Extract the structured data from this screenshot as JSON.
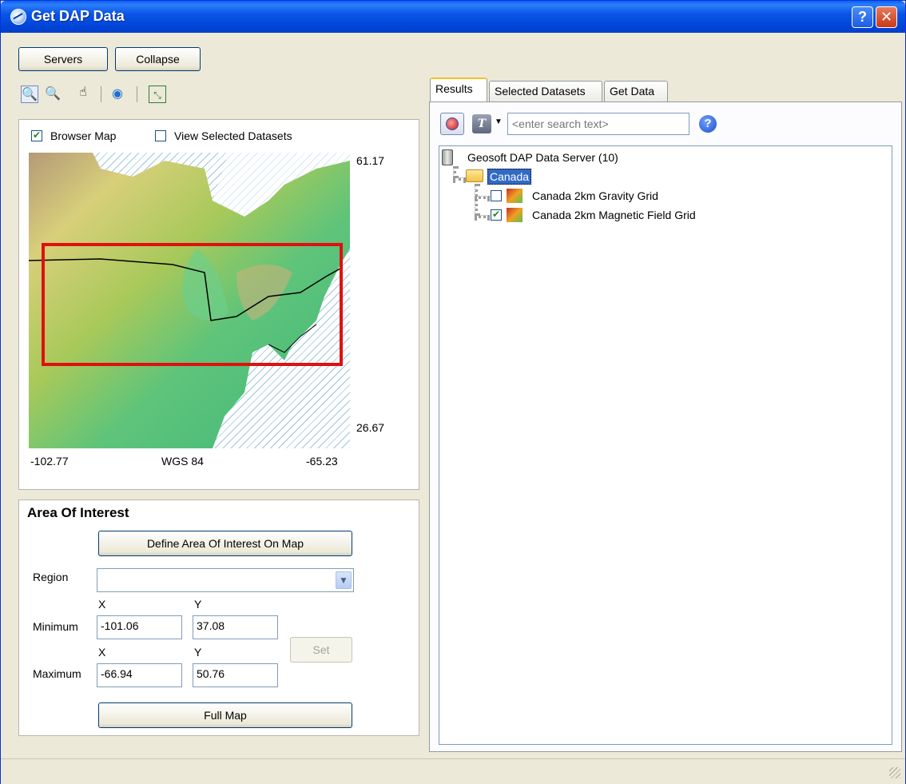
{
  "window": {
    "title": "Get DAP Data",
    "help_glyph": "?",
    "close_glyph": "✕"
  },
  "top_buttons": {
    "servers": "Servers",
    "collapse": "Collapse"
  },
  "map_panel": {
    "browser_map_label": "Browser Map",
    "browser_map_checked": true,
    "view_selected_label": "View Selected Datasets",
    "view_selected_checked": false,
    "lat_max": "61.17",
    "lat_min": "26.67",
    "lon_min": "-102.77",
    "lon_max": "-65.23",
    "projection": "WGS 84"
  },
  "aoi": {
    "heading": "Area Of Interest",
    "define_button": "Define Area Of Interest On Map",
    "region_label": "Region",
    "region_value": "",
    "x_header": "X",
    "y_header": "Y",
    "minimum_label": "Minimum",
    "maximum_label": "Maximum",
    "min_x": "-101.06",
    "min_y": "37.08",
    "max_x": "-66.94",
    "max_y": "50.76",
    "set_button": "Set",
    "full_map_button": "Full Map"
  },
  "tabs": [
    "Results",
    "Selected Datasets",
    "Get Data"
  ],
  "search": {
    "placeholder": "<enter search text>"
  },
  "tree": {
    "server": "Geosoft DAP Data Server (10)",
    "folder": "Canada",
    "items": [
      {
        "label": "Canada 2km Gravity Grid",
        "checked": false
      },
      {
        "label": "Canada 2km Magnetic Field Grid",
        "checked": true
      }
    ]
  },
  "colors": {
    "accent": "#0A56E8",
    "aoi_box": "#E01010",
    "map_green": "#4cc27a"
  }
}
